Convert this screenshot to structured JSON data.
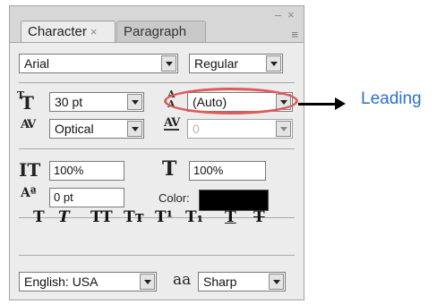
{
  "window": {
    "minimize": "–",
    "close": "×"
  },
  "tabs": [
    {
      "label": "Character",
      "close": "×"
    },
    {
      "label": "Paragraph"
    }
  ],
  "menu_icon": "≡",
  "font": {
    "family": "Arial",
    "style": "Regular"
  },
  "size": {
    "value": "30 pt",
    "icon": "font-size-icon"
  },
  "leading": {
    "value": "(Auto)",
    "icon": "leading-icon"
  },
  "kerning": {
    "value": "Optical",
    "icon": "kerning-icon"
  },
  "tracking": {
    "value": "0",
    "icon": "tracking-icon"
  },
  "vertical_scale": {
    "value": "100%"
  },
  "horizontal_scale": {
    "value": "100%"
  },
  "baseline_shift": {
    "value": "0 pt"
  },
  "color": {
    "label": "Color:",
    "value": "#000000"
  },
  "format_buttons": [
    "T",
    "T",
    "TT",
    "Tт",
    "T¹",
    "T₁",
    "T",
    "T"
  ],
  "language": {
    "value": "English: USA"
  },
  "antialias": {
    "icon_text": "aa",
    "value": "Sharp"
  },
  "annotation": {
    "label": "Leading",
    "highlight_color": "#e05a5a",
    "label_color": "#2f6fcf"
  }
}
